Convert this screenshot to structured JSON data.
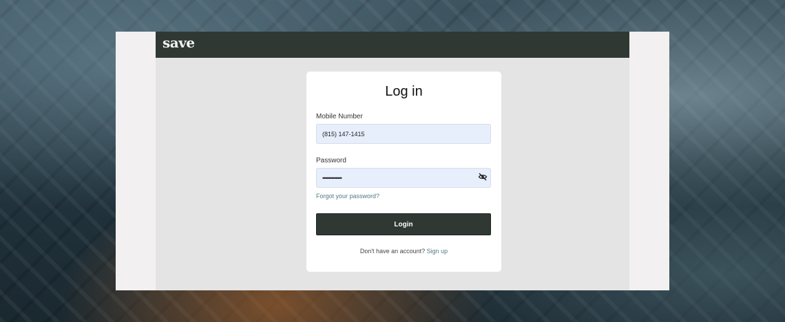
{
  "app": {
    "logo": "save"
  },
  "login": {
    "title": "Log in",
    "mobile_label": "Mobile Number",
    "mobile_value": "(815) 147-1415",
    "password_label": "Password",
    "password_value": "•••••••••••••",
    "forgot_link": "Forgot your password?",
    "login_button": "Login",
    "no_account_text": "Don't have an account?",
    "signup_link": "Sign up"
  },
  "colors": {
    "brand_dark": "#2f3833",
    "input_bg": "#e8effc",
    "link": "#4f7a86"
  },
  "icons": {
    "password_toggle": "eye-slash-icon"
  }
}
